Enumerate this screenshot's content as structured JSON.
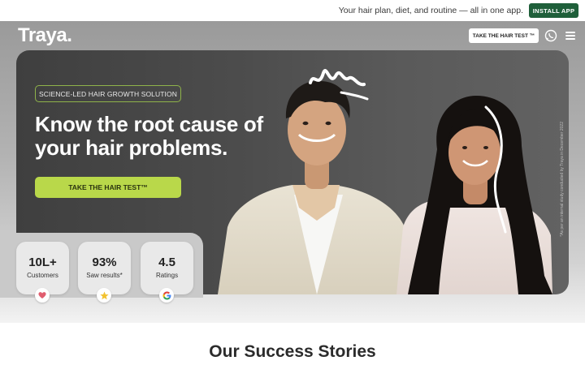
{
  "topbar": {
    "text": "Your hair plan, diet, and  routine — all in one app.",
    "install_label": "INSTALL APP"
  },
  "nav": {
    "logo": "Traya.",
    "cta_label": "TAKE THE HAIR TEST ™",
    "icons": [
      "whatsapp-icon",
      "menu-icon"
    ]
  },
  "hero": {
    "tag": "SCIENCE-LED HAIR GROWTH SOLUTION",
    "headline": "Know the root cause of your hair problems.",
    "cta_label": "TAKE THE HAIR TEST™",
    "disclaimer": "*As per an internal study conducted by Traya in December 2022"
  },
  "stats": [
    {
      "value": "10L+",
      "label": "Customers",
      "icon": "heart-icon"
    },
    {
      "value": "93%",
      "label": "Saw results*",
      "icon": "star-icon"
    },
    {
      "value": "4.5",
      "label": "Ratings",
      "icon": "google-icon"
    }
  ],
  "section": {
    "title": "Our Success Stories"
  },
  "colors": {
    "brand_green": "#1f5f3a",
    "cta_green": "#b9d84a",
    "tag_border": "#8fb34a",
    "card_bg": "#4c4c4c"
  }
}
